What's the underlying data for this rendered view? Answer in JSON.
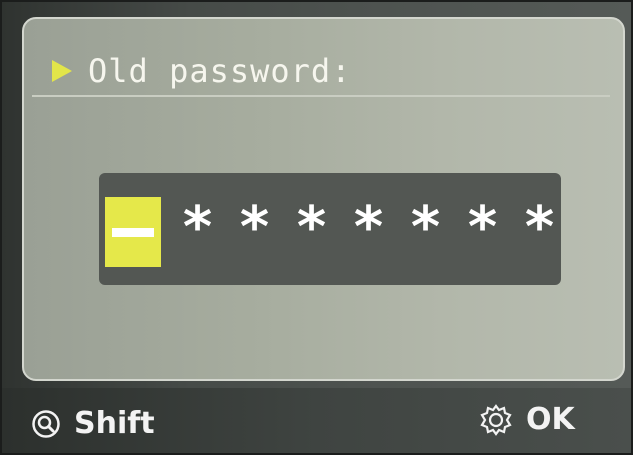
{
  "header": {
    "title": "Old password:"
  },
  "password": {
    "mask": [
      "*",
      "*",
      "*",
      "*",
      "*",
      "*",
      "*"
    ]
  },
  "footer": {
    "shift_label": "Shift",
    "ok_label": "OK"
  },
  "colors": {
    "accent": "#e5e84a",
    "text": "#ffffff"
  }
}
